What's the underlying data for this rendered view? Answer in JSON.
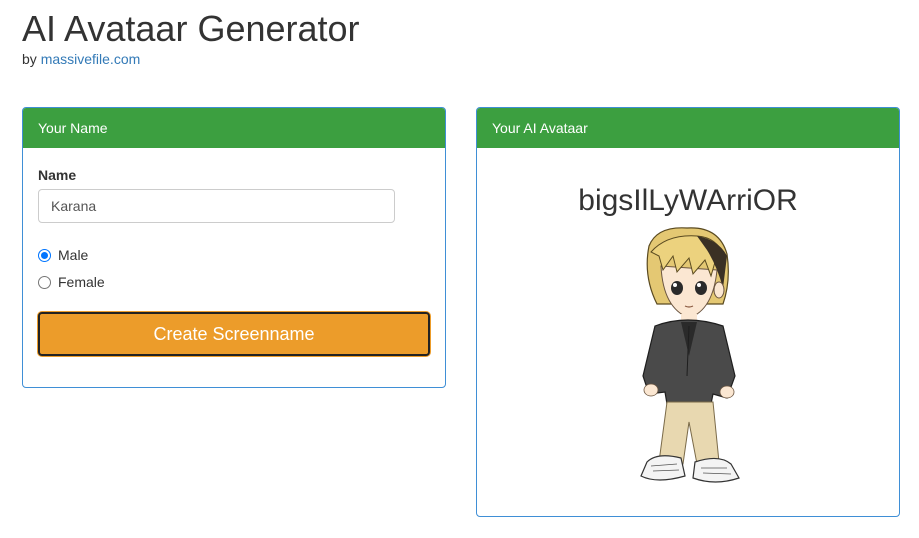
{
  "header": {
    "title": "AI Avataar Generator",
    "by_prefix": "by",
    "by_link": "massivefile.com"
  },
  "name_panel": {
    "heading": "Your Name",
    "name_label": "Name",
    "name_value": "Karana",
    "gender_options": [
      {
        "label": "Male",
        "checked": true
      },
      {
        "label": "Female",
        "checked": false
      }
    ],
    "button_label": "Create Screenname"
  },
  "avatar_panel": {
    "heading": "Your AI Avataar",
    "screenname": "bigsIlLyWArriOR",
    "avatar_description": "anime-style chibi character with blond hair, dark jacket, khaki pants and sneakers"
  },
  "colors": {
    "panel_heading": "#3c9f40",
    "panel_border": "#3f8fd6",
    "button": "#ec9c2a",
    "link": "#337ab7",
    "radio_checked": "#0075ff"
  }
}
